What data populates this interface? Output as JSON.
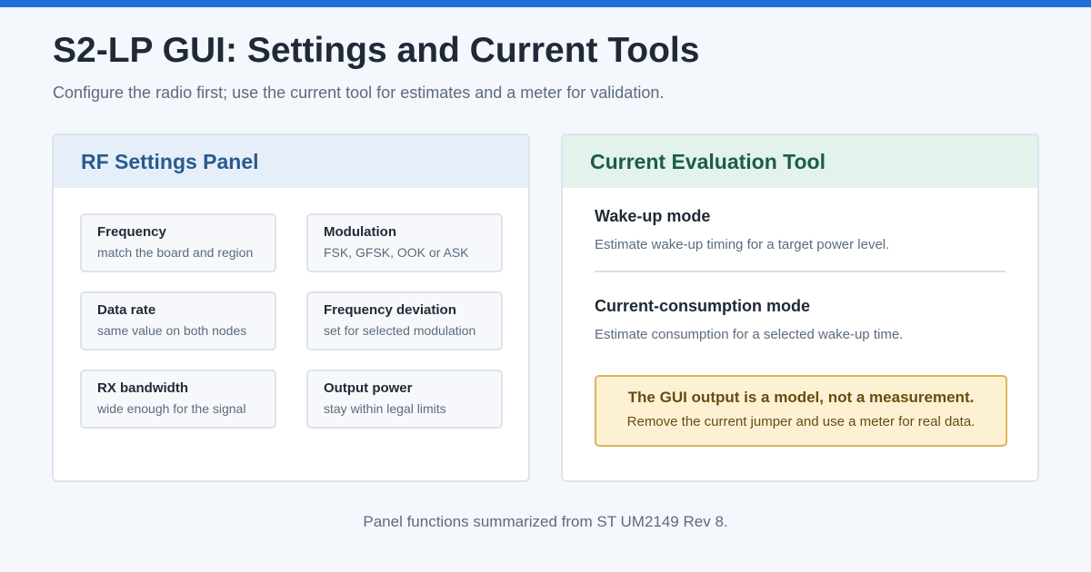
{
  "header": {
    "title": "S2-LP GUI: Settings and Current Tools",
    "subtitle": "Configure the radio first; use the current tool for estimates and a meter for validation."
  },
  "rf_panel": {
    "title": "RF Settings Panel",
    "settings": [
      {
        "title": "Frequency",
        "desc": "match the board and region"
      },
      {
        "title": "Modulation",
        "desc": "FSK, GFSK, OOK or ASK"
      },
      {
        "title": "Data rate",
        "desc": "same value on both nodes"
      },
      {
        "title": "Frequency deviation",
        "desc": "set for selected modulation"
      },
      {
        "title": "RX bandwidth",
        "desc": "wide enough for the signal"
      },
      {
        "title": "Output power",
        "desc": "stay within legal limits"
      }
    ]
  },
  "current_panel": {
    "title": "Current Evaluation Tool",
    "modes": [
      {
        "title": "Wake-up mode",
        "desc": "Estimate wake-up timing for a target power level."
      },
      {
        "title": "Current-consumption mode",
        "desc": "Estimate consumption for a selected wake-up time."
      }
    ],
    "notice": {
      "title": "The GUI output is a model, not a measurement.",
      "body": "Remove the current jumper and use a meter for real data."
    }
  },
  "footer": "Panel functions summarized from ST UM2149 Rev 8.",
  "colors": {
    "accent_bar": "#1e6fd9",
    "rf_header_bg": "#e6eff9",
    "rf_header_text": "#285b8f",
    "current_header_bg": "#e4f2ec",
    "current_header_text": "#1a5f45",
    "notice_bg": "#fdf1d4",
    "notice_border": "#deb45b"
  }
}
